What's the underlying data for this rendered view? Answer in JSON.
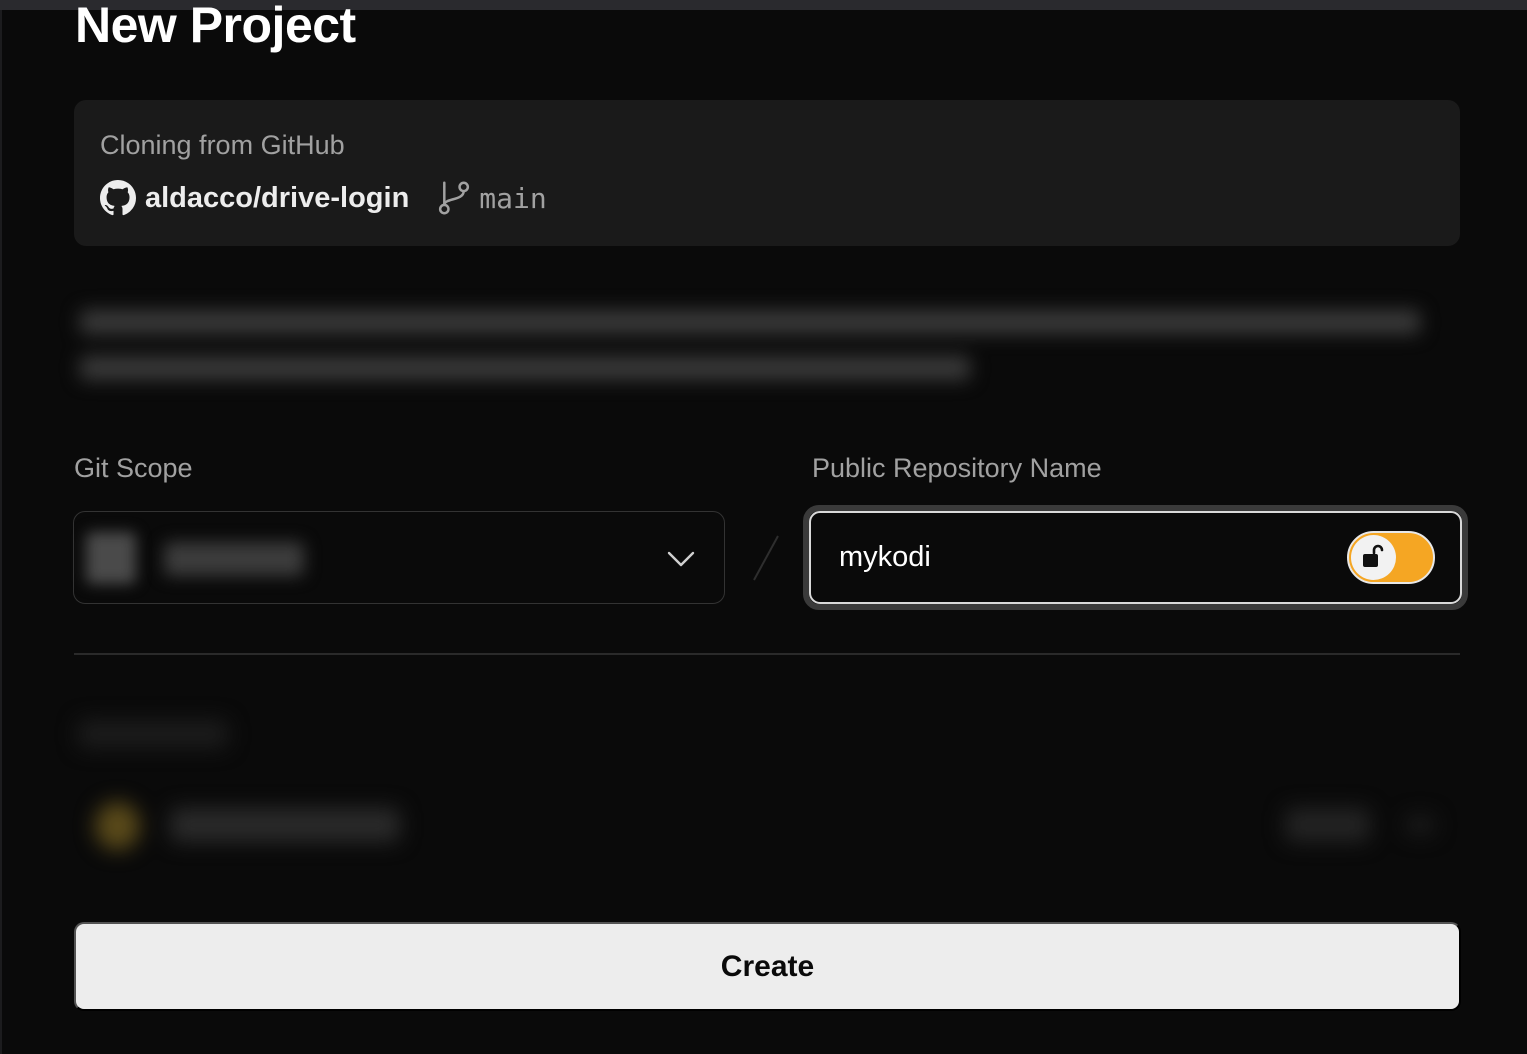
{
  "page": {
    "title": "New Project"
  },
  "clone": {
    "label": "Cloning from GitHub",
    "repo": "aldacco/drive-login",
    "branch": "main",
    "repo_icon": "github-icon",
    "branch_icon": "git-branch-icon"
  },
  "git_scope": {
    "label": "Git Scope",
    "dropdown_icon": "chevron-down-icon"
  },
  "repository": {
    "label": "Public Repository Name",
    "value": "mykodi",
    "visibility_toggle": {
      "state": "public",
      "icon": "unlock-icon",
      "color": "#f5a623"
    }
  },
  "actions": {
    "create_label": "Create"
  }
}
